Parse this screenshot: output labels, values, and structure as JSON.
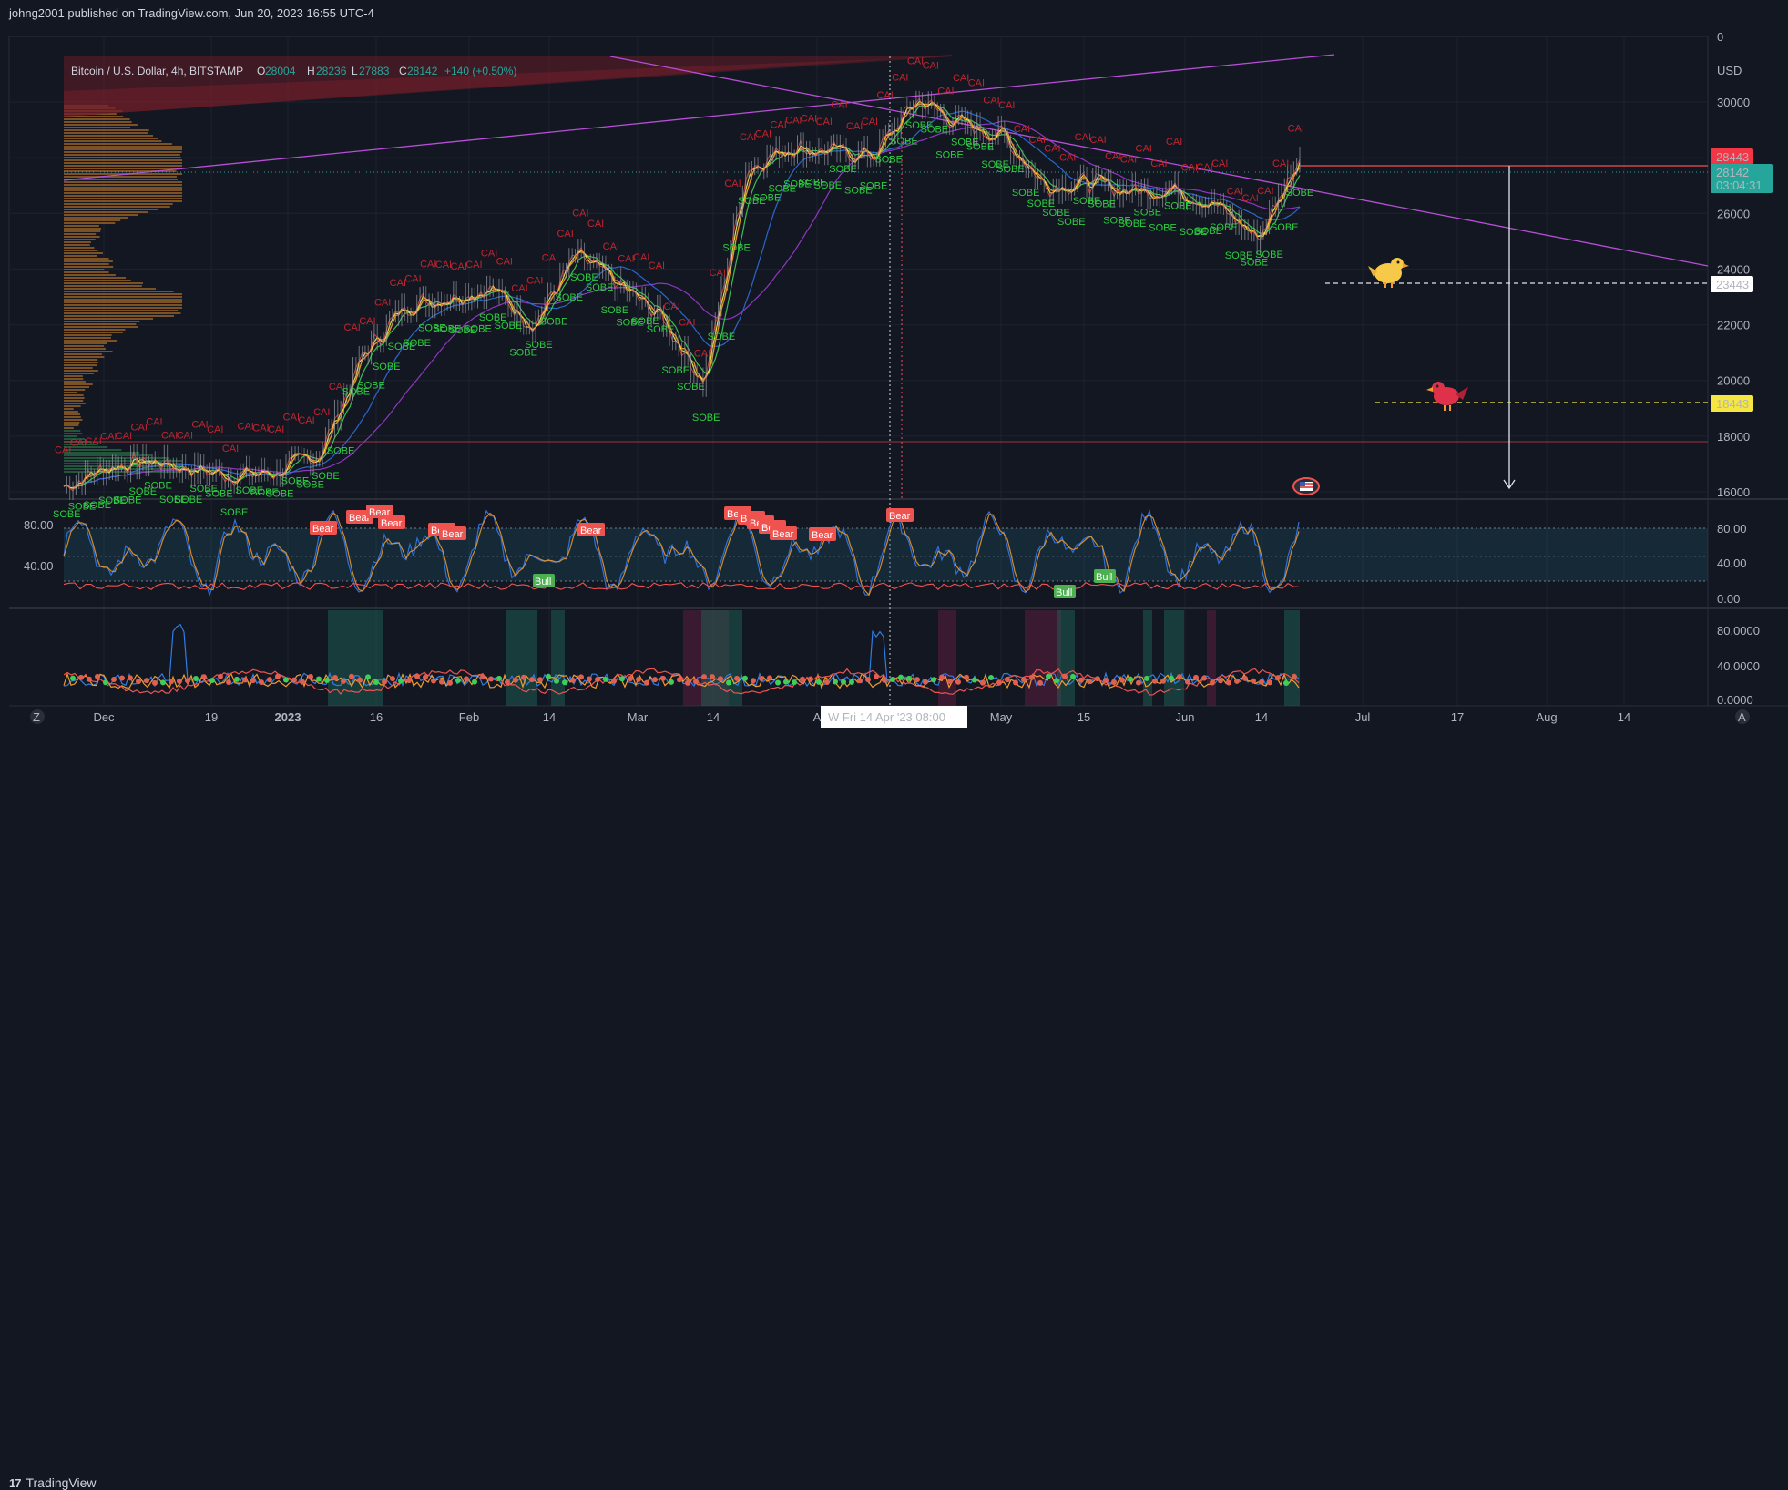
{
  "header": {
    "published_text": "johng2001 published on TradingView.com, Jun 20, 2023 16:55 UTC-4"
  },
  "footer": {
    "brand": "TradingView",
    "logo_mark": "17"
  },
  "colors": {
    "bg": "#131722",
    "up": "#26a69a",
    "down": "#ef5350",
    "grid": "#1e222d",
    "magenta": "#b74fd6",
    "yellow": "#f5e642"
  },
  "legend": {
    "symbol": "Bitcoin / U.S. Dollar, 4h, BITSTAMP",
    "o_label": "O",
    "o_value": "28004",
    "h_label": "H",
    "h_value": "28236",
    "l_label": "L",
    "l_value": "27883",
    "c_label": "C",
    "c_value": "28142",
    "change": "+140 (+0.50%)"
  },
  "price_axis": {
    "unit": "USD",
    "top_tick": "0",
    "ticks": [
      "30000",
      "28000",
      "26000",
      "24000",
      "22000",
      "20000",
      "18000",
      "16000"
    ]
  },
  "price_labels": {
    "resistance": "28443",
    "last_price": "28142",
    "countdown": "03:04:31",
    "level_white": "23443",
    "level_yellow": "18443"
  },
  "osc1_axis": {
    "left_ticks": [
      "80.00",
      "40.00"
    ],
    "right_ticks": [
      "80.00",
      "40.00",
      "0.00"
    ]
  },
  "osc2_axis": {
    "right_ticks": [
      "80.0000",
      "40.0000",
      "0.0000"
    ]
  },
  "time_axis": {
    "ticks": [
      "Dec",
      "19",
      "2023",
      "16",
      "Feb",
      "14",
      "Mar",
      "14",
      "A",
      "May",
      "15",
      "Jun",
      "14",
      "Jul",
      "17",
      "Aug",
      "14"
    ],
    "bold_tick": "2023",
    "crosshair_label": "W   Fri 14 Apr '23   08:00",
    "left_button": "Z",
    "right_button": "A"
  },
  "annotations": {
    "cai": "CAI",
    "sobe": "SOBE",
    "bear": "Bear",
    "bull": "Bull"
  },
  "chart_data": {
    "type": "line",
    "title": "Bitcoin / U.S. Dollar, 4h, BITSTAMP",
    "ylabel": "USD",
    "ylim": [
      14500,
      31500
    ],
    "x": [
      "2022-11-28",
      "2022-12-05",
      "2022-12-12",
      "2022-12-19",
      "2022-12-26",
      "2023-01-02",
      "2023-01-09",
      "2023-01-16",
      "2023-01-23",
      "2023-01-30",
      "2023-02-06",
      "2023-02-13",
      "2023-02-20",
      "2023-02-27",
      "2023-03-06",
      "2023-03-13",
      "2023-03-20",
      "2023-03-27",
      "2023-04-03",
      "2023-04-10",
      "2023-04-17",
      "2023-04-24",
      "2023-05-01",
      "2023-05-08",
      "2023-05-15",
      "2023-05-22",
      "2023-05-29",
      "2023-06-05",
      "2023-06-12",
      "2023-06-19"
    ],
    "series": [
      {
        "values": [
          16200,
          16900,
          17100,
          16800,
          16600,
          16700,
          17400,
          20900,
          22700,
          23000,
          23300,
          22000,
          24500,
          23400,
          22300,
          19900,
          27600,
          28400,
          28200,
          28100,
          30100,
          29200,
          28800,
          27000,
          27100,
          26800,
          26900,
          26300,
          25100,
          28142
        ]
      }
    ],
    "levels": [
      28443,
      23443,
      18443
    ],
    "osc1_ylim": [
      0,
      100
    ],
    "osc2_ylim": [
      0,
      100
    ]
  }
}
